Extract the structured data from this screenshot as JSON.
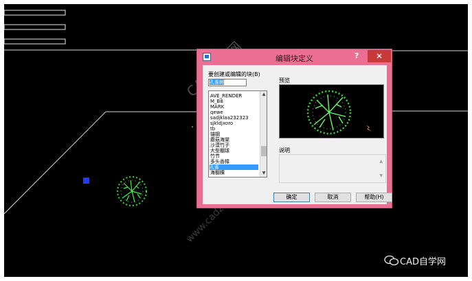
{
  "dialog": {
    "title": "编辑块定义",
    "help_glyph": "?",
    "close_glyph": "✕",
    "create_or_edit_label": "要创建或编辑的块(B)",
    "name_value": "孔雀树",
    "preview_label": "预览",
    "description_label": "说明",
    "list_items": [
      "AVE_RENDER",
      "M_B8",
      "MARK",
      "qewe",
      "sadjklaa232323",
      "sjkldjxoro",
      "tb",
      "锚钢",
      "蘑菇海棠",
      "沙漠竹子",
      "大型棚球",
      "竹节",
      "多头香樟",
      "孔雀",
      "海棚棵"
    ],
    "selected_item": "孔雀",
    "ok_label": "确定",
    "cancel_label": "取消",
    "help_label": "帮助(H)"
  },
  "watermark": {
    "site": "CAD自学网",
    "url": "www.cadzxw.com"
  },
  "brand": {
    "label": "CAD自学网",
    "icon": "wechat-icon"
  }
}
